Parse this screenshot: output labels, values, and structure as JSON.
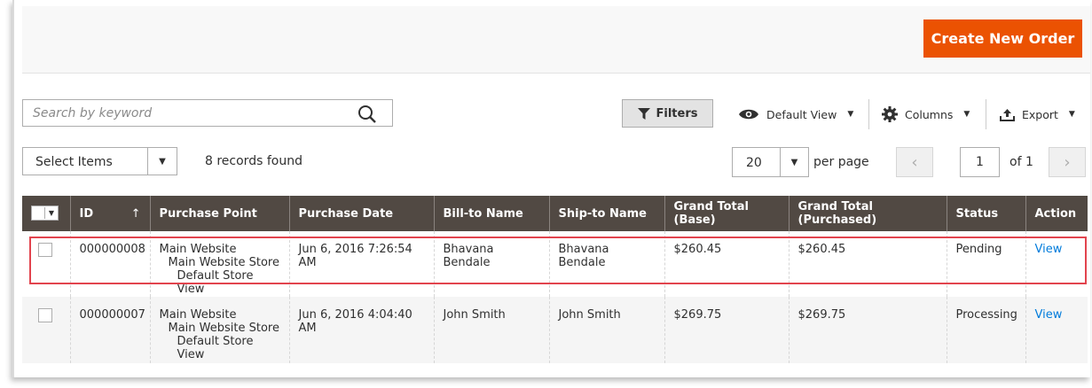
{
  "header": {
    "create_button": "Create New Order"
  },
  "search": {
    "placeholder": "Search by keyword"
  },
  "toolbar": {
    "filters": "Filters",
    "view": "Default View",
    "columns": "Columns",
    "export": "Export"
  },
  "mass_actions": {
    "label": "Select Items"
  },
  "records_found": "8 records found",
  "pagination": {
    "per_page_value": "20",
    "per_page_label": "per page",
    "current_page": "1",
    "of_label": "of 1"
  },
  "columns": [
    "ID",
    "Purchase Point",
    "Purchase Date",
    "Bill-to Name",
    "Ship-to Name",
    "Grand Total (Base)",
    "Grand Total (Purchased)",
    "Status",
    "Action"
  ],
  "rows": [
    {
      "id": "000000008",
      "purchase_point": [
        "Main Website",
        "Main Website Store",
        "Default Store View"
      ],
      "purchase_date": "Jun 6, 2016 7:26:54 AM",
      "bill_to": "Bhavana Bendale",
      "ship_to": "Bhavana Bendale",
      "grand_total_base": "$260.45",
      "grand_total_purchased": "$260.45",
      "status": "Pending",
      "action": "View"
    },
    {
      "id": "000000007",
      "purchase_point": [
        "Main Website",
        "Main Website Store",
        "Default Store View"
      ],
      "purchase_date": "Jun 6, 2016 4:04:40 AM",
      "bill_to": "John Smith",
      "ship_to": "John Smith",
      "grand_total_base": "$269.75",
      "grand_total_purchased": "$269.75",
      "status": "Processing",
      "action": "View"
    }
  ],
  "colors": {
    "accent": "#eb5202",
    "header_bg": "#514943",
    "link": "#007bdb",
    "highlight": "#e2444e"
  }
}
